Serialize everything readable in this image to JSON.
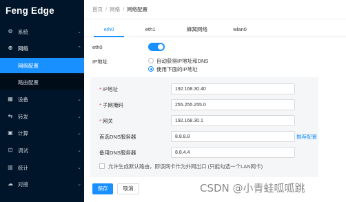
{
  "app": {
    "logo_text": "Feng Edge"
  },
  "sidebar": {
    "items": [
      {
        "label": "系统",
        "icon": "gear-icon"
      },
      {
        "label": "网络",
        "icon": "globe-icon"
      },
      {
        "label": "设备",
        "icon": "device-icon"
      },
      {
        "label": "转发",
        "icon": "forward-icon"
      },
      {
        "label": "计算",
        "icon": "calculator-icon"
      },
      {
        "label": "调试",
        "icon": "debug-icon"
      },
      {
        "label": "统计",
        "icon": "chart-icon"
      },
      {
        "label": "对接",
        "icon": "cloud-icon"
      }
    ],
    "subitems": [
      {
        "label": "网络配置",
        "active": true
      },
      {
        "label": "路由配置",
        "active": false
      }
    ]
  },
  "breadcrumb": {
    "home": "首页",
    "section": "网络",
    "current": "网络配置"
  },
  "tabs": [
    "eth0",
    "eth1",
    "蜂窝网络",
    "wlan0"
  ],
  "form": {
    "enable_label": "eth0",
    "ip_label": "IP地址",
    "radio_auto": "自动获得IP地址和DNS",
    "radio_manual": "使用下面的IP地址",
    "fields": {
      "ip": {
        "label": "IP地址",
        "value": "192.168.30.40"
      },
      "mask": {
        "label": "子网掩码",
        "value": "255.255.255.0"
      },
      "gateway": {
        "label": "网关",
        "value": "192.168.30.1"
      },
      "dns1": {
        "label": "首选DNS服务器",
        "value": "8.8.8.8"
      },
      "dns2": {
        "label": "备用DNS服务器",
        "value": "8.8.4.4"
      }
    },
    "recommend_link": "推荐配置",
    "default_route_label": "允许生成默认路由，即该网卡作为外网出口 (只能勾选一个LAN网卡)"
  },
  "buttons": {
    "save": "保存",
    "cancel": "取消"
  },
  "watermark": "CSDN @小青蛙呱呱跳",
  "colors": {
    "sidebar_bg": "#001529",
    "accent": "#1890ff",
    "panel_bg": "#f5f6f8"
  }
}
